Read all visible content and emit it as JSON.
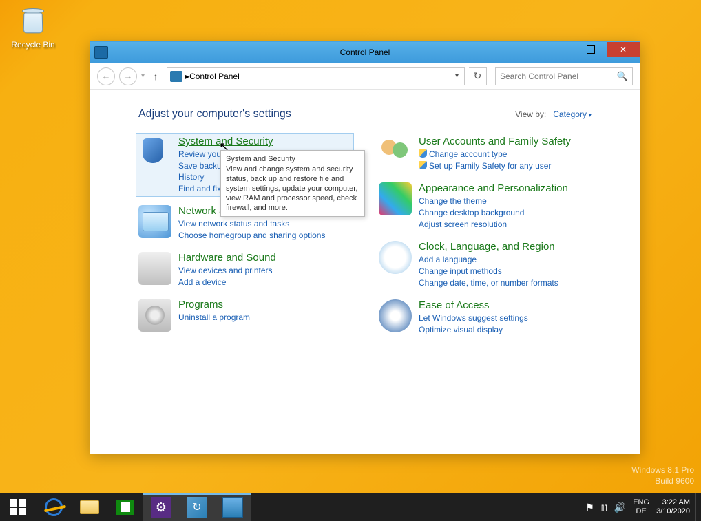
{
  "desktop": {
    "recycle_bin": "Recycle Bin"
  },
  "watermark": {
    "line1": "Windows 8.1 Pro",
    "line2": "Build 9600"
  },
  "window": {
    "title": "Control Panel",
    "breadcrumb": "Control Panel",
    "search_placeholder": "Search Control Panel"
  },
  "header": {
    "title": "Adjust your computer's settings",
    "viewby_label": "View by:",
    "viewby_value": "Category"
  },
  "tooltip": {
    "title": "System and Security",
    "body": "View and change system and security status, back up and restore file and system settings, update your computer, view RAM and processor speed, check firewall, and more."
  },
  "cats": {
    "left": [
      {
        "id": "system-security",
        "title": "System and Security",
        "links": [
          "Review your computer's status",
          "Save backup copies of your files with File History",
          "Find and fix problems"
        ]
      },
      {
        "id": "network-internet",
        "title": "Network and Internet",
        "links": [
          "View network status and tasks",
          "Choose homegroup and sharing options"
        ]
      },
      {
        "id": "hardware-sound",
        "title": "Hardware and Sound",
        "links": [
          "View devices and printers",
          "Add a device"
        ]
      },
      {
        "id": "programs",
        "title": "Programs",
        "links": [
          "Uninstall a program"
        ]
      }
    ],
    "right": [
      {
        "id": "user-accounts",
        "title": "User Accounts and Family Safety",
        "links": [
          "Change account type",
          "Set up Family Safety for any user"
        ],
        "shield": [
          0,
          1
        ]
      },
      {
        "id": "appearance",
        "title": "Appearance and Personalization",
        "links": [
          "Change the theme",
          "Change desktop background",
          "Adjust screen resolution"
        ]
      },
      {
        "id": "clock-region",
        "title": "Clock, Language, and Region",
        "links": [
          "Add a language",
          "Change input methods",
          "Change date, time, or number formats"
        ]
      },
      {
        "id": "ease-access",
        "title": "Ease of Access",
        "links": [
          "Let Windows suggest settings",
          "Optimize visual display"
        ]
      }
    ]
  },
  "tray": {
    "lang1": "ENG",
    "lang2": "DE",
    "time": "3:22 AM",
    "date": "3/10/2020"
  }
}
